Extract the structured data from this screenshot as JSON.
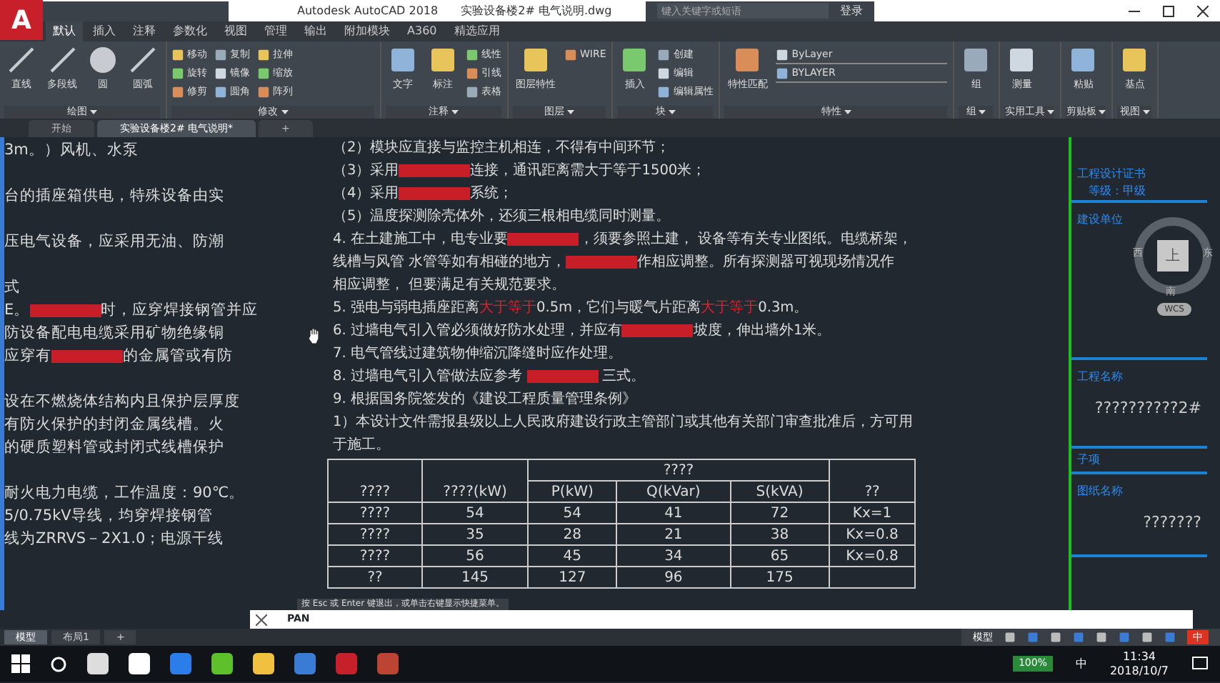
{
  "window": {
    "logo": "A",
    "title": "Autodesk AutoCAD 2018",
    "file": "实验设备楼2# 电气说明.dwg",
    "search": {
      "placeholder": "键入关键字或短语"
    },
    "login": "登录"
  },
  "ribbon_tabs": [
    {
      "label": "默认",
      "selected": true
    },
    {
      "label": "插入",
      "selected": false
    },
    {
      "label": "注释",
      "selected": false
    },
    {
      "label": "参数化",
      "selected": false
    },
    {
      "label": "视图",
      "selected": false
    },
    {
      "label": "管理",
      "selected": false
    },
    {
      "label": "输出",
      "selected": false
    },
    {
      "label": "附加模块",
      "selected": false
    },
    {
      "label": "A360",
      "selected": false
    },
    {
      "label": "精选应用",
      "selected": false
    }
  ],
  "panels": [
    {
      "title": "绘图",
      "big": [
        "直线",
        "多段线",
        "圆",
        "圆弧"
      ]
    },
    {
      "title": "修改",
      "small": [
        "移动",
        "旋转",
        "修剪",
        "复制",
        "镜像",
        "圆角",
        "拉伸",
        "缩放",
        "阵列"
      ]
    },
    {
      "title": "注释",
      "big": [
        "文字",
        "标注"
      ],
      "small": [
        "线性",
        "引线",
        "表格"
      ]
    },
    {
      "title": "图层",
      "big": [
        "图层特性"
      ],
      "small": [
        "WIRE"
      ]
    },
    {
      "title": "块",
      "big": [
        "插入"
      ],
      "small": [
        "创建",
        "编辑",
        "编辑属性"
      ]
    },
    {
      "title": "特性",
      "big": [
        "特性匹配"
      ],
      "small": [
        "ByLayer",
        "BYLAYER"
      ]
    },
    {
      "title": "组",
      "big": [
        "组"
      ]
    },
    {
      "title": "实用工具",
      "big": [
        "测量"
      ]
    },
    {
      "title": "剪贴板",
      "big": [
        "粘贴"
      ]
    },
    {
      "title": "视图",
      "big": [
        "基点"
      ]
    }
  ],
  "doc_tabs": [
    {
      "label": "开始",
      "selected": false
    },
    {
      "label": "实验设备楼2# 电气说明*",
      "selected": true
    }
  ],
  "doc_tabs_add": "+",
  "left_paragraphs": [
    [
      [
        {
          "text": "3m。）风机、水泵"
        }
      ]
    ],
    [
      [
        {
          "text": "台的插座箱供电，特殊设备由实"
        }
      ]
    ],
    [
      [
        {
          "text": "压电气设备，应采用无油、防潮"
        }
      ]
    ],
    [
      [
        {
          "text": "式"
        }
      ],
      [
        {
          "text": "E。"
        },
        {
          "kind": "redacted"
        },
        {
          "text": "时，应穿焊接钢管并应"
        }
      ],
      [
        {
          "text": "防设备配电电缆采用矿物绝缘铜"
        }
      ],
      [
        {
          "text": "应穿有"
        },
        {
          "kind": "redacted"
        },
        {
          "text": "的金属管或有防"
        }
      ]
    ],
    [
      [
        {
          "text": "设在不燃烧体结构内且保护层厚度"
        }
      ],
      [
        {
          "text": "有防火保护的封闭金属线槽。火"
        }
      ],
      [
        {
          "text": "的硬质塑料管或封闭式线槽保护"
        }
      ]
    ],
    [
      [
        {
          "text": "耐火电力电缆，工作温度：90℃。"
        }
      ],
      [
        {
          "text": "5/0.75kV导线，均穿焊接钢管"
        }
      ],
      [
        {
          "text": "线为ZRRVS－2X1.0；电源干线"
        }
      ]
    ]
  ],
  "notes": [
    [
      {
        "text": "（2）模块应直接与监控主机相连，不得有中间环节；"
      }
    ],
    [
      {
        "text": "（3）采用"
      },
      {
        "kind": "redacted"
      },
      {
        "text": "连接，通讯距离需大于等于1500米；"
      }
    ],
    [
      {
        "text": "（4）采用"
      },
      {
        "kind": "redacted"
      },
      {
        "text": "系统；"
      }
    ],
    [
      {
        "text": "（5）温度探测除壳体外，还须三根相电缆同时测量。"
      }
    ],
    [
      {
        "text": "4. 在土建施工中，电专业要"
      },
      {
        "kind": "redacted"
      },
      {
        "text": "，须要参照土建，  设备等有关专业图纸。电缆桥架，"
      }
    ],
    [
      {
        "text": "线槽与风管 水管等如有相碰的地方，"
      },
      {
        "kind": "redacted"
      },
      {
        "text": "作相应调整。所有探测器可视现场情况作"
      }
    ],
    [
      {
        "text": "相应调整，  但要满足有关规范要求。"
      }
    ],
    [
      {
        "text": "5. 强电与弱电插座距离"
      },
      {
        "kind": "red",
        "text": "大于等于"
      },
      {
        "text": "0.5m，它们与暖气片距离"
      },
      {
        "kind": "red",
        "text": "大于等于"
      },
      {
        "text": "0.3m。"
      }
    ],
    [
      {
        "text": "6. 过墙电气引入管必须做好防水处理，并应有"
      },
      {
        "kind": "redacted"
      },
      {
        "text": "坡度，伸出墙外1米。"
      }
    ],
    [
      {
        "text": "7. 电气管线过建筑物伸缩沉降缝时应作处理。"
      }
    ],
    [
      {
        "text": "8. 过墙电气引入管做法应参考 "
      },
      {
        "kind": "redacted"
      },
      {
        "text": " 三式。"
      }
    ],
    [
      {
        "text": "9. 根据国务院签发的《建设工程质量管理条例》"
      }
    ],
    [
      {
        "text": "1）本设计文件需报县级以上人民政府建设行政主管部门或其他有关部门审查批准后，方可用"
      }
    ],
    [
      {
        "text": "于施工。"
      }
    ]
  ],
  "table": {
    "column_1": "????",
    "column_2": "????(kW)",
    "group": "????",
    "sub_columns": [
      "P(kW)",
      "Q(kVar)",
      "S(kVA)"
    ],
    "column_6": "??",
    "rows": [
      [
        "????",
        "54",
        "54",
        "41",
        "72",
        "Kx=1"
      ],
      [
        "????",
        "35",
        "28",
        "21",
        "38",
        "Kx=0.8"
      ],
      [
        "????",
        "56",
        "45",
        "34",
        "65",
        "Kx=0.8"
      ],
      [
        "??",
        "145",
        "127",
        "96",
        "175",
        null
      ]
    ]
  },
  "title_block": {
    "cert": "工程设计证书",
    "grade": "等级：甲级",
    "fields": [
      {
        "label": "建设单位"
      },
      {
        "label": "工程名称",
        "value": "??????????2#"
      },
      {
        "label": "子项"
      },
      {
        "label": "图纸名称",
        "value": "???????"
      }
    ]
  },
  "viewcube": {
    "top": "上",
    "south": "南",
    "east": "东",
    "west": "西",
    "wcs": "WCS"
  },
  "command": {
    "history": "按 Esc 或 Enter 键退出，或单击右键显示快捷菜单。",
    "prompt": "PAN"
  },
  "layout_tabs": [
    {
      "label": "模型",
      "selected": true
    },
    {
      "label": "布局1",
      "selected": false
    }
  ],
  "layout_tabs_add": "+",
  "status_bar": {
    "space": "模型",
    "ime": "中"
  },
  "taskbar": {
    "battery": "100%",
    "ime": "中",
    "time": "11:34",
    "date": "2018/10/7"
  }
}
